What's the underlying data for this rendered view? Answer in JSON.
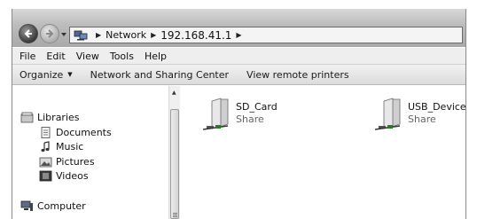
{
  "address_bar": {
    "crumbs": [
      "Network",
      "192.168.41.1"
    ]
  },
  "menu": [
    "File",
    "Edit",
    "View",
    "Tools",
    "Help"
  ],
  "command_bar": {
    "organize": "Organize",
    "network_sharing_center": "Network and Sharing Center",
    "view_remote_printers": "View remote printers"
  },
  "nav_pane": {
    "libraries": "Libraries",
    "documents": "Documents",
    "music": "Music",
    "pictures": "Pictures",
    "videos": "Videos",
    "computer": "Computer"
  },
  "shares": [
    {
      "name": "SD_Card",
      "type": "Share",
      "icon": "network-share-folder-icon"
    },
    {
      "name": "USB_Device",
      "type": "Share",
      "icon": "network-share-folder-icon"
    }
  ]
}
